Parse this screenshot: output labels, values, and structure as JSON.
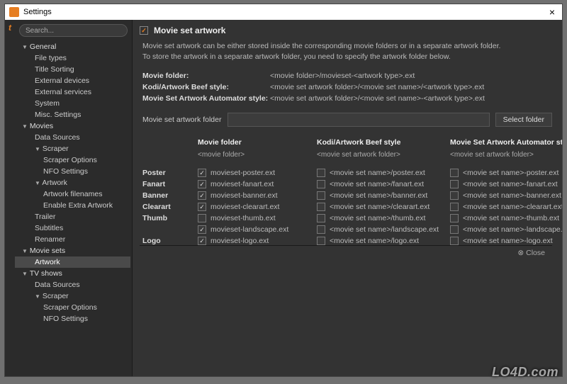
{
  "window": {
    "title": "Settings",
    "close": "×"
  },
  "search": {
    "placeholder": "Search..."
  },
  "sidebar": [
    {
      "type": "group",
      "label": "General",
      "expanded": true
    },
    {
      "type": "child",
      "label": "File types"
    },
    {
      "type": "child",
      "label": "Title Sorting"
    },
    {
      "type": "child",
      "label": "External devices"
    },
    {
      "type": "child",
      "label": "External services"
    },
    {
      "type": "child",
      "label": "System"
    },
    {
      "type": "child",
      "label": "Misc. Settings"
    },
    {
      "type": "group",
      "label": "Movies",
      "expanded": true
    },
    {
      "type": "child",
      "label": "Data Sources"
    },
    {
      "type": "childgroup",
      "label": "Scraper",
      "expanded": true
    },
    {
      "type": "child2",
      "label": "Scraper Options"
    },
    {
      "type": "child2",
      "label": "NFO Settings"
    },
    {
      "type": "childgroup",
      "label": "Artwork",
      "expanded": true
    },
    {
      "type": "child2",
      "label": "Artwork filenames"
    },
    {
      "type": "child2",
      "label": "Enable Extra Artwork"
    },
    {
      "type": "child",
      "label": "Trailer"
    },
    {
      "type": "child",
      "label": "Subtitles"
    },
    {
      "type": "child",
      "label": "Renamer"
    },
    {
      "type": "group",
      "label": "Movie sets",
      "expanded": true
    },
    {
      "type": "child",
      "label": "Artwork",
      "selected": true
    },
    {
      "type": "group",
      "label": "TV shows",
      "expanded": true
    },
    {
      "type": "child",
      "label": "Data Sources"
    },
    {
      "type": "childgroup",
      "label": "Scraper",
      "expanded": true
    },
    {
      "type": "child2",
      "label": "Scraper Options"
    },
    {
      "type": "child2",
      "label": "NFO Settings"
    }
  ],
  "section": {
    "title": "Movie set artwork",
    "desc1": "Movie set artwork can be either stored inside the corresponding movie folders or in a separate artwork folder.",
    "desc2": "To store the artwork in a separate artwork folder, you need to specify the artwork folder below."
  },
  "paths": [
    {
      "label": "Movie folder:",
      "val": "<movie folder>/movieset-<artwork type>.ext"
    },
    {
      "label": "Kodi/Artwork Beef style:",
      "val": "<movie set artwork folder>/<movie set name>/<artwork type>.ext"
    },
    {
      "label": "Movie Set Artwork Automator style:",
      "val": "<movie set artwork folder>/<movie set name>-<artwork type>.ext"
    }
  ],
  "folder": {
    "label": "Movie set artwork folder",
    "button": "Select folder"
  },
  "columns": {
    "c1": {
      "hdr": "Movie folder",
      "sub": "<movie folder>"
    },
    "c2": {
      "hdr": "Kodi/Artwork Beef style",
      "sub": "<movie set artwork folder>"
    },
    "c3": {
      "hdr": "Movie Set Artwork Automator style",
      "sub": "<movie set artwork folder>"
    }
  },
  "rows": [
    {
      "label": "Poster",
      "c1": {
        "chk": true,
        "txt": "movieset-poster.ext"
      },
      "c2": {
        "chk": false,
        "txt": "<movie set name>/poster.ext"
      },
      "c3": {
        "chk": false,
        "txt": "<movie set name>-poster.ext"
      }
    },
    {
      "label": "Fanart",
      "c1": {
        "chk": true,
        "txt": "movieset-fanart.ext"
      },
      "c2": {
        "chk": false,
        "txt": "<movie set name>/fanart.ext"
      },
      "c3": {
        "chk": false,
        "txt": "<movie set name>-fanart.ext"
      }
    },
    {
      "label": "Banner",
      "c1": {
        "chk": true,
        "txt": "movieset-banner.ext"
      },
      "c2": {
        "chk": false,
        "txt": "<movie set name>/banner.ext"
      },
      "c3": {
        "chk": false,
        "txt": "<movie set name>-banner.ext"
      }
    },
    {
      "label": "Clearart",
      "c1": {
        "chk": true,
        "txt": "movieset-clearart.ext"
      },
      "c2": {
        "chk": false,
        "txt": "<movie set name>/clearart.ext"
      },
      "c3": {
        "chk": false,
        "txt": "<movie set name>-clearart.ext"
      }
    },
    {
      "label": "Thumb",
      "c1a": {
        "chk": false,
        "txt": "movieset-thumb.ext"
      },
      "c2a": {
        "chk": false,
        "txt": "<movie set name>/thumb.ext"
      },
      "c3a": {
        "chk": false,
        "txt": "<movie set name>-thumb.ext"
      },
      "c1b": {
        "chk": true,
        "txt": "movieset-landscape.ext"
      },
      "c2b": {
        "chk": false,
        "txt": "<movie set name>/landscape.ext"
      },
      "c3b": {
        "chk": false,
        "txt": "<movie set name>-landscape.ext"
      }
    },
    {
      "label": "Logo",
      "c1": {
        "chk": true,
        "txt": "movieset-logo.ext"
      },
      "c2": {
        "chk": false,
        "txt": "<movie set name>/logo.ext"
      },
      "c3": {
        "chk": false,
        "txt": "<movie set name>-logo.ext"
      }
    }
  ],
  "footer": {
    "close": "Close"
  },
  "watermark": "LO4D.com"
}
